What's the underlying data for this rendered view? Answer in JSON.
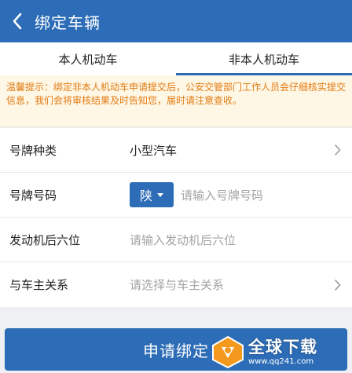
{
  "header": {
    "title": "绑定车辆",
    "back_icon": "chevron-left-icon"
  },
  "tabs": [
    {
      "label": "本人机动车",
      "active": false
    },
    {
      "label": "非本人机动车",
      "active": true
    }
  ],
  "notice": {
    "text": "温馨提示：绑定非本人机动车申请提交后，公安交管部门工作人员会仔细核实提交信息，我们会将审核结果及时告知您，届时请注意查收。"
  },
  "form": {
    "plate_type": {
      "label": "号牌种类",
      "value": "小型汽车"
    },
    "plate_number": {
      "label": "号牌号码",
      "province": "陕",
      "placeholder": "请输入号牌号码"
    },
    "engine": {
      "label": "发动机后六位",
      "placeholder": "请输入发动机后六位"
    },
    "relation": {
      "label": "与车主关系",
      "placeholder": "请选择与车主关系"
    }
  },
  "submit": {
    "label": "申请绑定"
  },
  "watermark": {
    "text": "全球下载",
    "url": "www.qq241.com"
  },
  "colors": {
    "primary": "#2d6db7",
    "notice_text": "#e07a12",
    "notice_bg": "#fff7e5",
    "watermark_orange": "#f39a1e"
  }
}
